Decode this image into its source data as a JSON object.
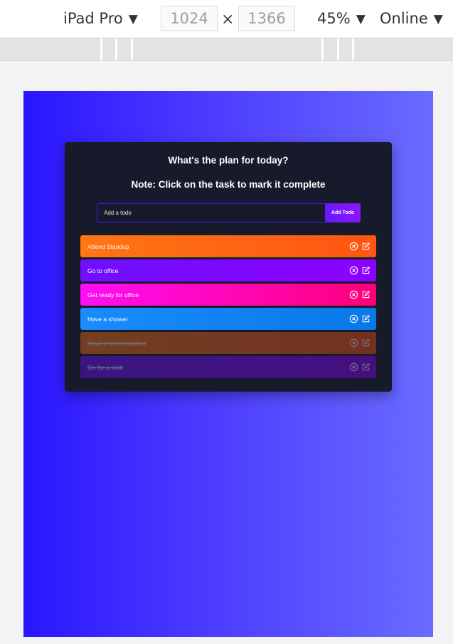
{
  "devtools": {
    "device": "iPad Pro",
    "width": "1024",
    "height": "1366",
    "separator": "×",
    "zoom": "45%",
    "network": "Online",
    "caret": "▼"
  },
  "app": {
    "title": "What's the plan for today?",
    "note": "Note: Click on the task to mark it complete",
    "input_placeholder": "Add a todo",
    "add_button_label": "Add Todo"
  },
  "todos": [
    {
      "text": "Attend Standup",
      "complete": false,
      "gradient": [
        "#ff7614",
        "#ff5513"
      ]
    },
    {
      "text": "Go to office",
      "complete": false,
      "gradient": [
        "#6f10ff",
        "#8d00ff"
      ]
    },
    {
      "text": "Get ready for office",
      "complete": false,
      "gradient": [
        "#ff0df6",
        "#ff0079"
      ]
    },
    {
      "text": "Have a shower",
      "complete": false,
      "gradient": [
        "#1a8cff",
        "#0978e8"
      ]
    },
    {
      "text": "Have a nice breakfast",
      "complete": true,
      "gradient": [
        "#ff7614",
        "#ff5513"
      ]
    },
    {
      "text": "Go for a walk",
      "complete": true,
      "gradient": [
        "#6f10ff",
        "#8d00ff"
      ]
    }
  ],
  "colors": {
    "viewport_gradient_start": "#2a16ff",
    "viewport_gradient_end": "#6a6bff",
    "app_background": "#161a2b",
    "accent": "#5d0cff"
  },
  "icons": {
    "delete": "close-circle-icon",
    "edit": "edit-icon"
  }
}
